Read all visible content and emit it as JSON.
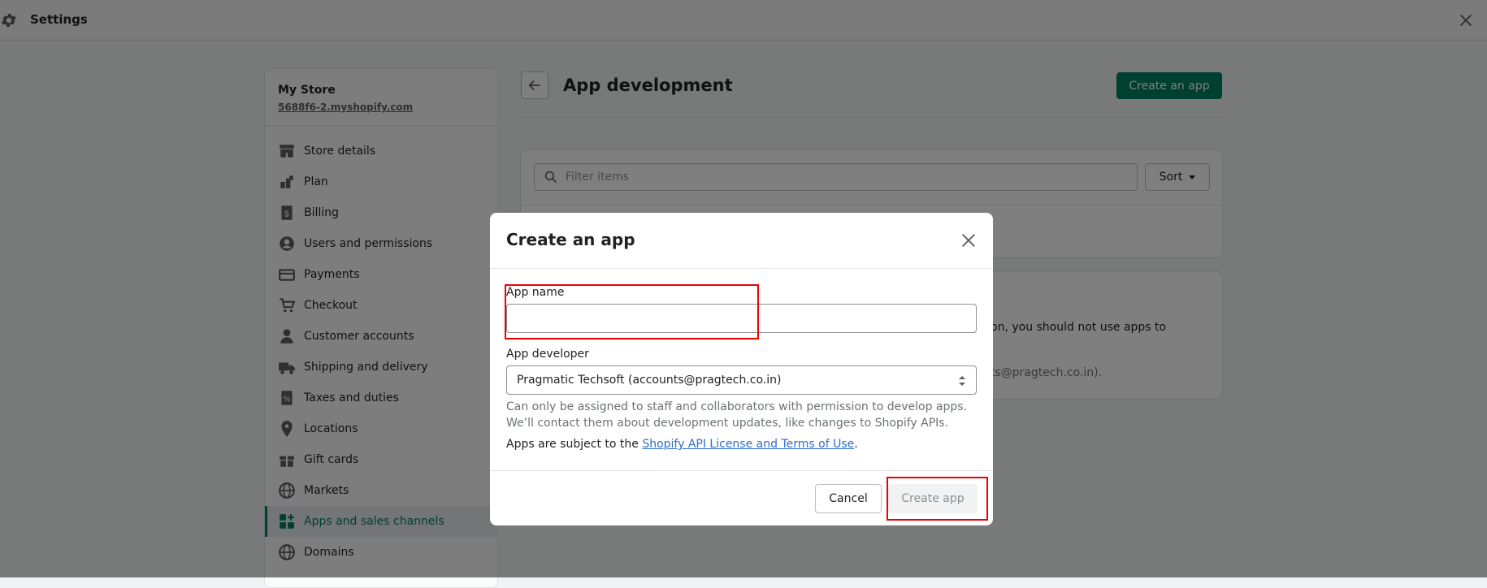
{
  "topbar": {
    "title": "Settings",
    "settings_icon": "gear-icon",
    "close_icon": "close-icon"
  },
  "sidebar": {
    "store_name": "My Store",
    "store_url": "5688f6-2.myshopify.com",
    "items": [
      {
        "label": "Store details",
        "icon": "store-icon"
      },
      {
        "label": "Plan",
        "icon": "plan-icon"
      },
      {
        "label": "Billing",
        "icon": "billing-icon"
      },
      {
        "label": "Users and permissions",
        "icon": "user-circle-icon"
      },
      {
        "label": "Payments",
        "icon": "payments-icon"
      },
      {
        "label": "Checkout",
        "icon": "cart-icon"
      },
      {
        "label": "Customer accounts",
        "icon": "person-icon"
      },
      {
        "label": "Shipping and delivery",
        "icon": "truck-icon"
      },
      {
        "label": "Taxes and duties",
        "icon": "tax-icon"
      },
      {
        "label": "Locations",
        "icon": "location-pin-icon"
      },
      {
        "label": "Gift cards",
        "icon": "gift-icon"
      },
      {
        "label": "Markets",
        "icon": "globe-icon"
      },
      {
        "label": "Apps and sales channels",
        "icon": "apps-icon",
        "active": true
      },
      {
        "label": "Domains",
        "icon": "globe-icon"
      }
    ]
  },
  "main": {
    "title": "App development",
    "create_button": "Create an app",
    "filter_placeholder": "Filter items",
    "sort_label": "Sort",
    "card_line1": "on, you should not use apps to",
    "card_line2": "nts@pragtech.co.in)."
  },
  "modal": {
    "title": "Create an app",
    "app_name_label": "App name",
    "app_name_value": "",
    "developer_label": "App developer",
    "developer_value": "Pragmatic Techsoft (accounts@pragtech.co.in)",
    "help_text": "Can only be assigned to staff and collaborators with permission to develop apps. We’ll contact them about development updates, like changes to Shopify APIs.",
    "terms_prefix": "Apps are subject to the ",
    "terms_link": "Shopify API License and Terms of Use",
    "terms_suffix": ".",
    "cancel_label": "Cancel",
    "create_label": "Create app"
  },
  "colors": {
    "accent": "#008060",
    "highlight": "#e00000",
    "link": "#2c6ecb"
  }
}
